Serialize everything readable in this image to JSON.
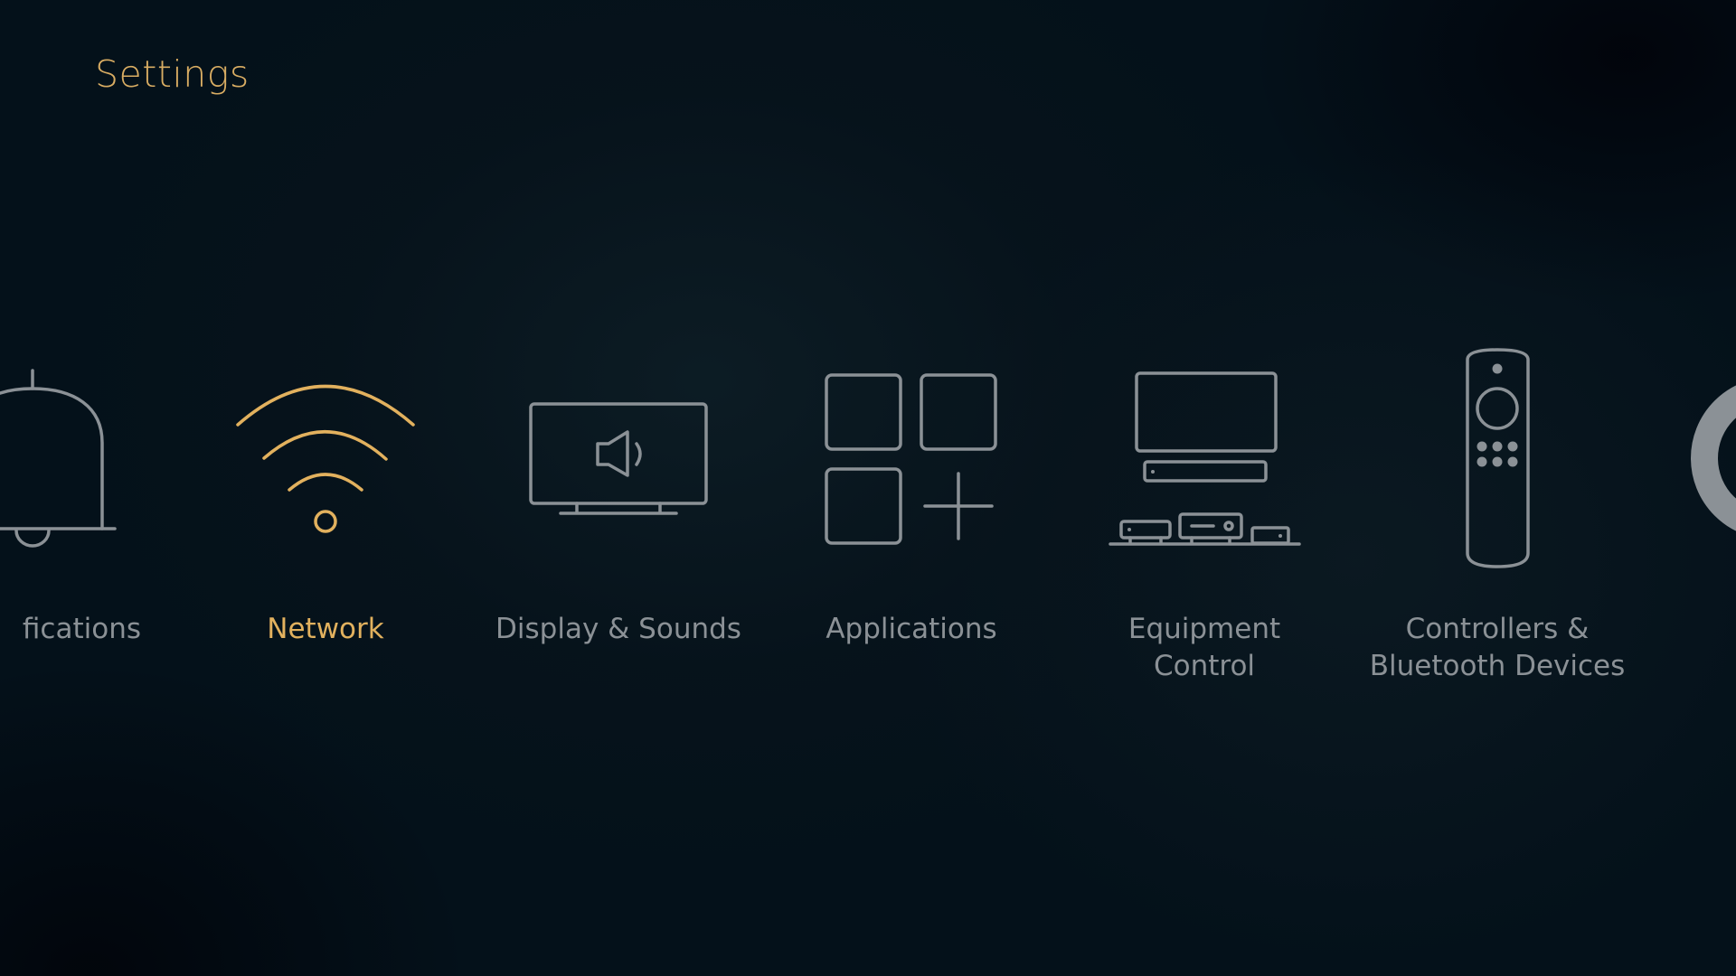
{
  "page": {
    "title": "Settings"
  },
  "theme": {
    "accent_color": "#E2B15E",
    "text_color": "#8B9196",
    "background": "#04111A"
  },
  "menu": {
    "selected_index": 1,
    "items": [
      {
        "label": "Notifications",
        "visible_label": "fications",
        "icon": "bell-icon"
      },
      {
        "label": "Network",
        "icon": "wifi-icon"
      },
      {
        "label": "Display & Sounds",
        "icon": "tv-speaker-icon"
      },
      {
        "label": "Applications",
        "icon": "apps-grid-plus-icon"
      },
      {
        "label": "Equipment\nControl",
        "icon": "tv-equipment-icon"
      },
      {
        "label": "Controllers &\nBluetooth Devices",
        "icon": "remote-control-icon"
      },
      {
        "label": "",
        "icon": "ring-icon"
      }
    ]
  }
}
